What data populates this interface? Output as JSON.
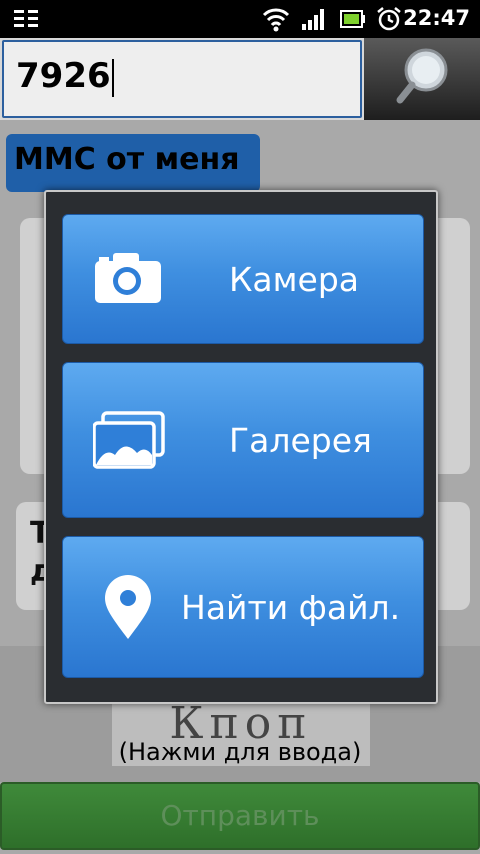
{
  "status_bar": {
    "time": "22:47",
    "icons": [
      "usb-debug-icon",
      "wifi-icon",
      "signal-icon",
      "battery-icon",
      "alarm-icon"
    ]
  },
  "search": {
    "value": "7926",
    "button_icon": "search-icon"
  },
  "background": {
    "mms_label": "ММС от меня",
    "bubble_line1": "Т",
    "bubble_line2": "д",
    "signature_text": "Кпоп",
    "press_hint": "(Нажми для ввода)",
    "send_label": "Отправить"
  },
  "dialog": {
    "options": [
      {
        "label": "Камера",
        "icon": "camera-icon"
      },
      {
        "label": "Галерея",
        "icon": "gallery-icon"
      },
      {
        "label": "Найти файл.",
        "icon": "location-pin-icon"
      }
    ]
  },
  "colors": {
    "option_blue": "#3f8fe0",
    "send_green": "#3f8a3a",
    "mms_blue": "#1f5fa8"
  }
}
